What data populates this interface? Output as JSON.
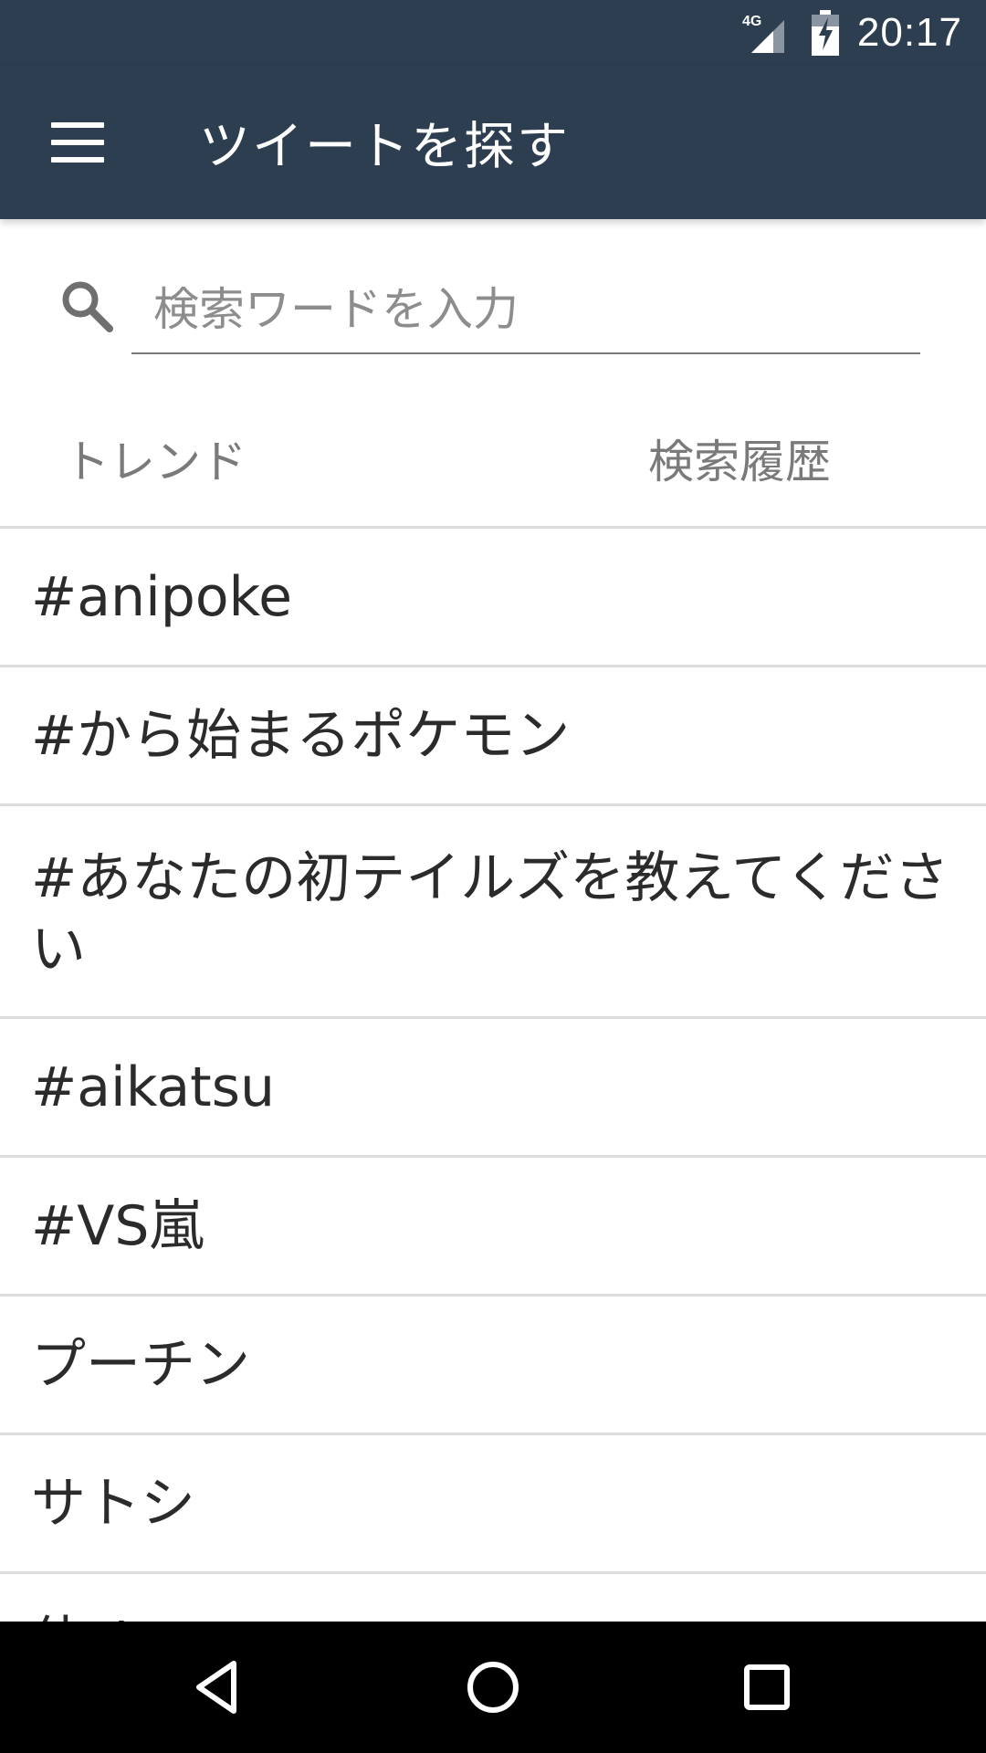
{
  "status_bar": {
    "network": "4G",
    "time": "20:17"
  },
  "app_bar": {
    "title": "ツイートを探す"
  },
  "search": {
    "placeholder": "検索ワードを入力"
  },
  "tabs": [
    {
      "label": "トレンド"
    },
    {
      "label": "検索履歴"
    }
  ],
  "trends": [
    {
      "label": "#anipoke"
    },
    {
      "label": "#から始まるポケモン"
    },
    {
      "label": "#あなたの初テイルズを教えてください"
    },
    {
      "label": "#aikatsu"
    },
    {
      "label": "#VS嵐"
    },
    {
      "label": "プーチン"
    },
    {
      "label": "サトシ"
    },
    {
      "label": "侍Ｊ"
    }
  ],
  "icons": {
    "menu": "hamburger-menu-icon",
    "search": "search-icon",
    "back": "back-triangle-icon",
    "home": "home-circle-icon",
    "recents": "recents-square-icon"
  },
  "colors": {
    "app_bar": "#2d3e50",
    "nav_bar": "#000000",
    "divider": "#dddddd",
    "text_primary": "#2b2b2b",
    "text_secondary": "#7a7a7a"
  }
}
